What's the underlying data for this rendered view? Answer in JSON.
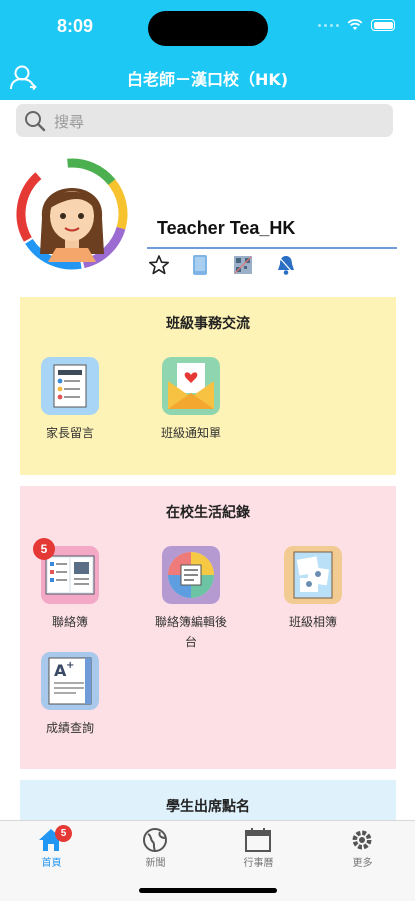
{
  "status_bar": {
    "time": "8:09"
  },
  "header": {
    "title": "白老師－漢口校（HK)"
  },
  "search": {
    "placeholder": "搜尋"
  },
  "profile": {
    "name": "Teacher Tea_HK"
  },
  "sections": [
    {
      "title": "班級事務交流",
      "color": "#fdf3b6",
      "tiles": [
        {
          "label": "家長留言"
        },
        {
          "label": "班級通知單"
        }
      ]
    },
    {
      "title": "在校生活紀錄",
      "color": "#fde0e6",
      "tiles": [
        {
          "label": "聯絡簿",
          "badge": "5"
        },
        {
          "label": "聯絡簿編輯後台"
        },
        {
          "label": "班級相簿"
        },
        {
          "label": "成績查詢"
        }
      ]
    },
    {
      "title": "學生出席點名",
      "color": "#dff1fb"
    }
  ],
  "tabbar": [
    {
      "label": "首頁",
      "badge": "5",
      "icon": "home-icon"
    },
    {
      "label": "新聞",
      "icon": "globe-icon"
    },
    {
      "label": "行事曆",
      "icon": "calendar-icon"
    },
    {
      "label": "更多",
      "icon": "gear-icon"
    }
  ],
  "colors": {
    "header": "#1ec8f5",
    "active_tab": "#2196f3",
    "badge": "#e53935"
  }
}
